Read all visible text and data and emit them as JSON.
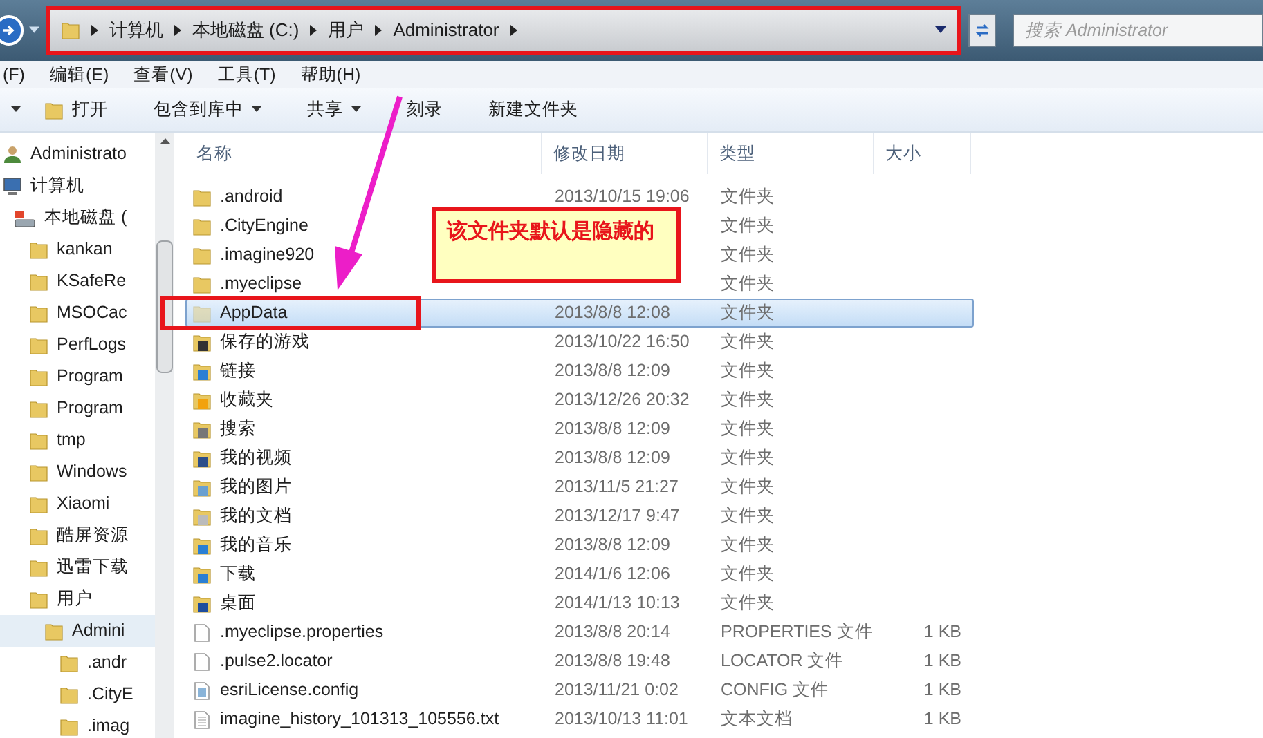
{
  "address_bar": {
    "crumbs": [
      "计算机",
      "本地磁盘 (C:)",
      "用户",
      "Administrator"
    ],
    "highlighted": true,
    "search_placeholder": "搜索 Administrator"
  },
  "menu": [
    "(F)",
    "编辑(E)",
    "查看(V)",
    "工具(T)",
    "帮助(H)"
  ],
  "toolbar": [
    {
      "label": "打开",
      "kind": "icon"
    },
    {
      "label": "包含到库中",
      "kind": "dropdown"
    },
    {
      "label": "共享",
      "kind": "dropdown"
    },
    {
      "label": "刻录",
      "kind": "plain"
    },
    {
      "label": "新建文件夹",
      "kind": "plain"
    }
  ],
  "sidebar": [
    {
      "label": "Administrato",
      "kind": "user",
      "selected": false
    },
    {
      "label": "计算机",
      "kind": "computer",
      "selected": false,
      "children": [
        {
          "label": "本地磁盘 (",
          "kind": "drive",
          "selected": false,
          "children": [
            {
              "label": "kankan",
              "kind": "folder",
              "selected": false
            },
            {
              "label": "KSafeRe",
              "kind": "folder",
              "selected": false
            },
            {
              "label": "MSOCac",
              "kind": "folder",
              "selected": false
            },
            {
              "label": "PerfLogs",
              "kind": "folder",
              "selected": false
            },
            {
              "label": "Program",
              "kind": "folder",
              "selected": false
            },
            {
              "label": "Program",
              "kind": "folder",
              "selected": false
            },
            {
              "label": "tmp",
              "kind": "folder",
              "selected": false
            },
            {
              "label": "Windows",
              "kind": "folder",
              "selected": false
            },
            {
              "label": "Xiaomi",
              "kind": "folder",
              "selected": false
            },
            {
              "label": "酷屏资源",
              "kind": "folder",
              "selected": false
            },
            {
              "label": "迅雷下载",
              "kind": "folder",
              "selected": false
            },
            {
              "label": "用户",
              "kind": "folder",
              "selected": false,
              "children": [
                {
                  "label": "Admini",
                  "kind": "folder",
                  "selected": true,
                  "children": [
                    {
                      "label": ".andr",
                      "kind": "folder",
                      "selected": false
                    },
                    {
                      "label": ".CityE",
                      "kind": "folder",
                      "selected": false
                    },
                    {
                      "label": ".imag",
                      "kind": "folder",
                      "selected": false
                    }
                  ]
                }
              ]
            }
          ]
        }
      ]
    }
  ],
  "table": {
    "columns": [
      "名称",
      "修改日期",
      "类型",
      "大小"
    ],
    "rows": [
      {
        "name": ".android",
        "date": "2013/10/15 19:06",
        "type": "文件夹",
        "kind": "folder",
        "selected": false,
        "hidden": false,
        "highlighted": false
      },
      {
        "name": ".CityEngine",
        "date": "",
        "type": "文件夹",
        "kind": "folder",
        "selected": false,
        "hidden": false,
        "highlighted": false
      },
      {
        "name": ".imagine920",
        "date": "",
        "type": "文件夹",
        "kind": "folder",
        "selected": false,
        "hidden": false,
        "highlighted": false
      },
      {
        "name": ".myeclipse",
        "date": "",
        "type": "文件夹",
        "kind": "folder",
        "selected": false,
        "hidden": false,
        "highlighted": false
      },
      {
        "name": "AppData",
        "date": "2013/8/8 12:08",
        "type": "文件夹",
        "kind": "folder",
        "selected": true,
        "hidden": true,
        "highlighted": true
      },
      {
        "name": "保存的游戏",
        "date": "2013/10/22 16:50",
        "type": "文件夹",
        "kind": "games",
        "selected": false,
        "hidden": false,
        "highlighted": false
      },
      {
        "name": "链接",
        "date": "2013/8/8 12:09",
        "type": "文件夹",
        "kind": "link",
        "selected": false,
        "hidden": false,
        "highlighted": false
      },
      {
        "name": "收藏夹",
        "date": "2013/12/26 20:32",
        "type": "文件夹",
        "kind": "star",
        "selected": false,
        "hidden": false,
        "highlighted": false
      },
      {
        "name": "搜索",
        "date": "2013/8/8 12:09",
        "type": "文件夹",
        "kind": "search",
        "selected": false,
        "hidden": false,
        "highlighted": false
      },
      {
        "name": "我的视频",
        "date": "2013/8/8 12:09",
        "type": "文件夹",
        "kind": "video",
        "selected": false,
        "hidden": false,
        "highlighted": false
      },
      {
        "name": "我的图片",
        "date": "2013/11/5 21:27",
        "type": "文件夹",
        "kind": "picture",
        "selected": false,
        "hidden": false,
        "highlighted": false
      },
      {
        "name": "我的文档",
        "date": "2013/12/17 9:47",
        "type": "文件夹",
        "kind": "document",
        "selected": false,
        "hidden": false,
        "highlighted": false
      },
      {
        "name": "我的音乐",
        "date": "2013/8/8 12:09",
        "type": "文件夹",
        "kind": "music",
        "selected": false,
        "hidden": false,
        "highlighted": false
      },
      {
        "name": "下载",
        "date": "2014/1/6 12:06",
        "type": "文件夹",
        "kind": "download",
        "selected": false,
        "hidden": false,
        "highlighted": false
      },
      {
        "name": "桌面",
        "date": "2014/1/13 10:13",
        "type": "文件夹",
        "kind": "desktop",
        "selected": false,
        "hidden": false,
        "highlighted": false
      },
      {
        "name": ".myeclipse.properties",
        "date": "2013/8/8 20:14",
        "type": "PROPERTIES 文件",
        "size": "1 KB",
        "kind": "file",
        "selected": false,
        "hidden": false,
        "highlighted": false
      },
      {
        "name": ".pulse2.locator",
        "date": "2013/8/8 19:48",
        "type": "LOCATOR 文件",
        "size": "1 KB",
        "kind": "file",
        "selected": false,
        "hidden": false,
        "highlighted": false
      },
      {
        "name": "esriLicense.config",
        "date": "2013/11/21 0:02",
        "type": "CONFIG 文件",
        "size": "1 KB",
        "kind": "config",
        "selected": false,
        "hidden": false,
        "highlighted": false
      },
      {
        "name": "imagine_history_101313_105556.txt",
        "date": "2013/10/13 11:01",
        "type": "文本文档",
        "size": "1 KB",
        "kind": "text",
        "selected": false,
        "hidden": false,
        "highlighted": false
      }
    ]
  },
  "callout": {
    "text": "该文件夹默认是隐藏的"
  }
}
